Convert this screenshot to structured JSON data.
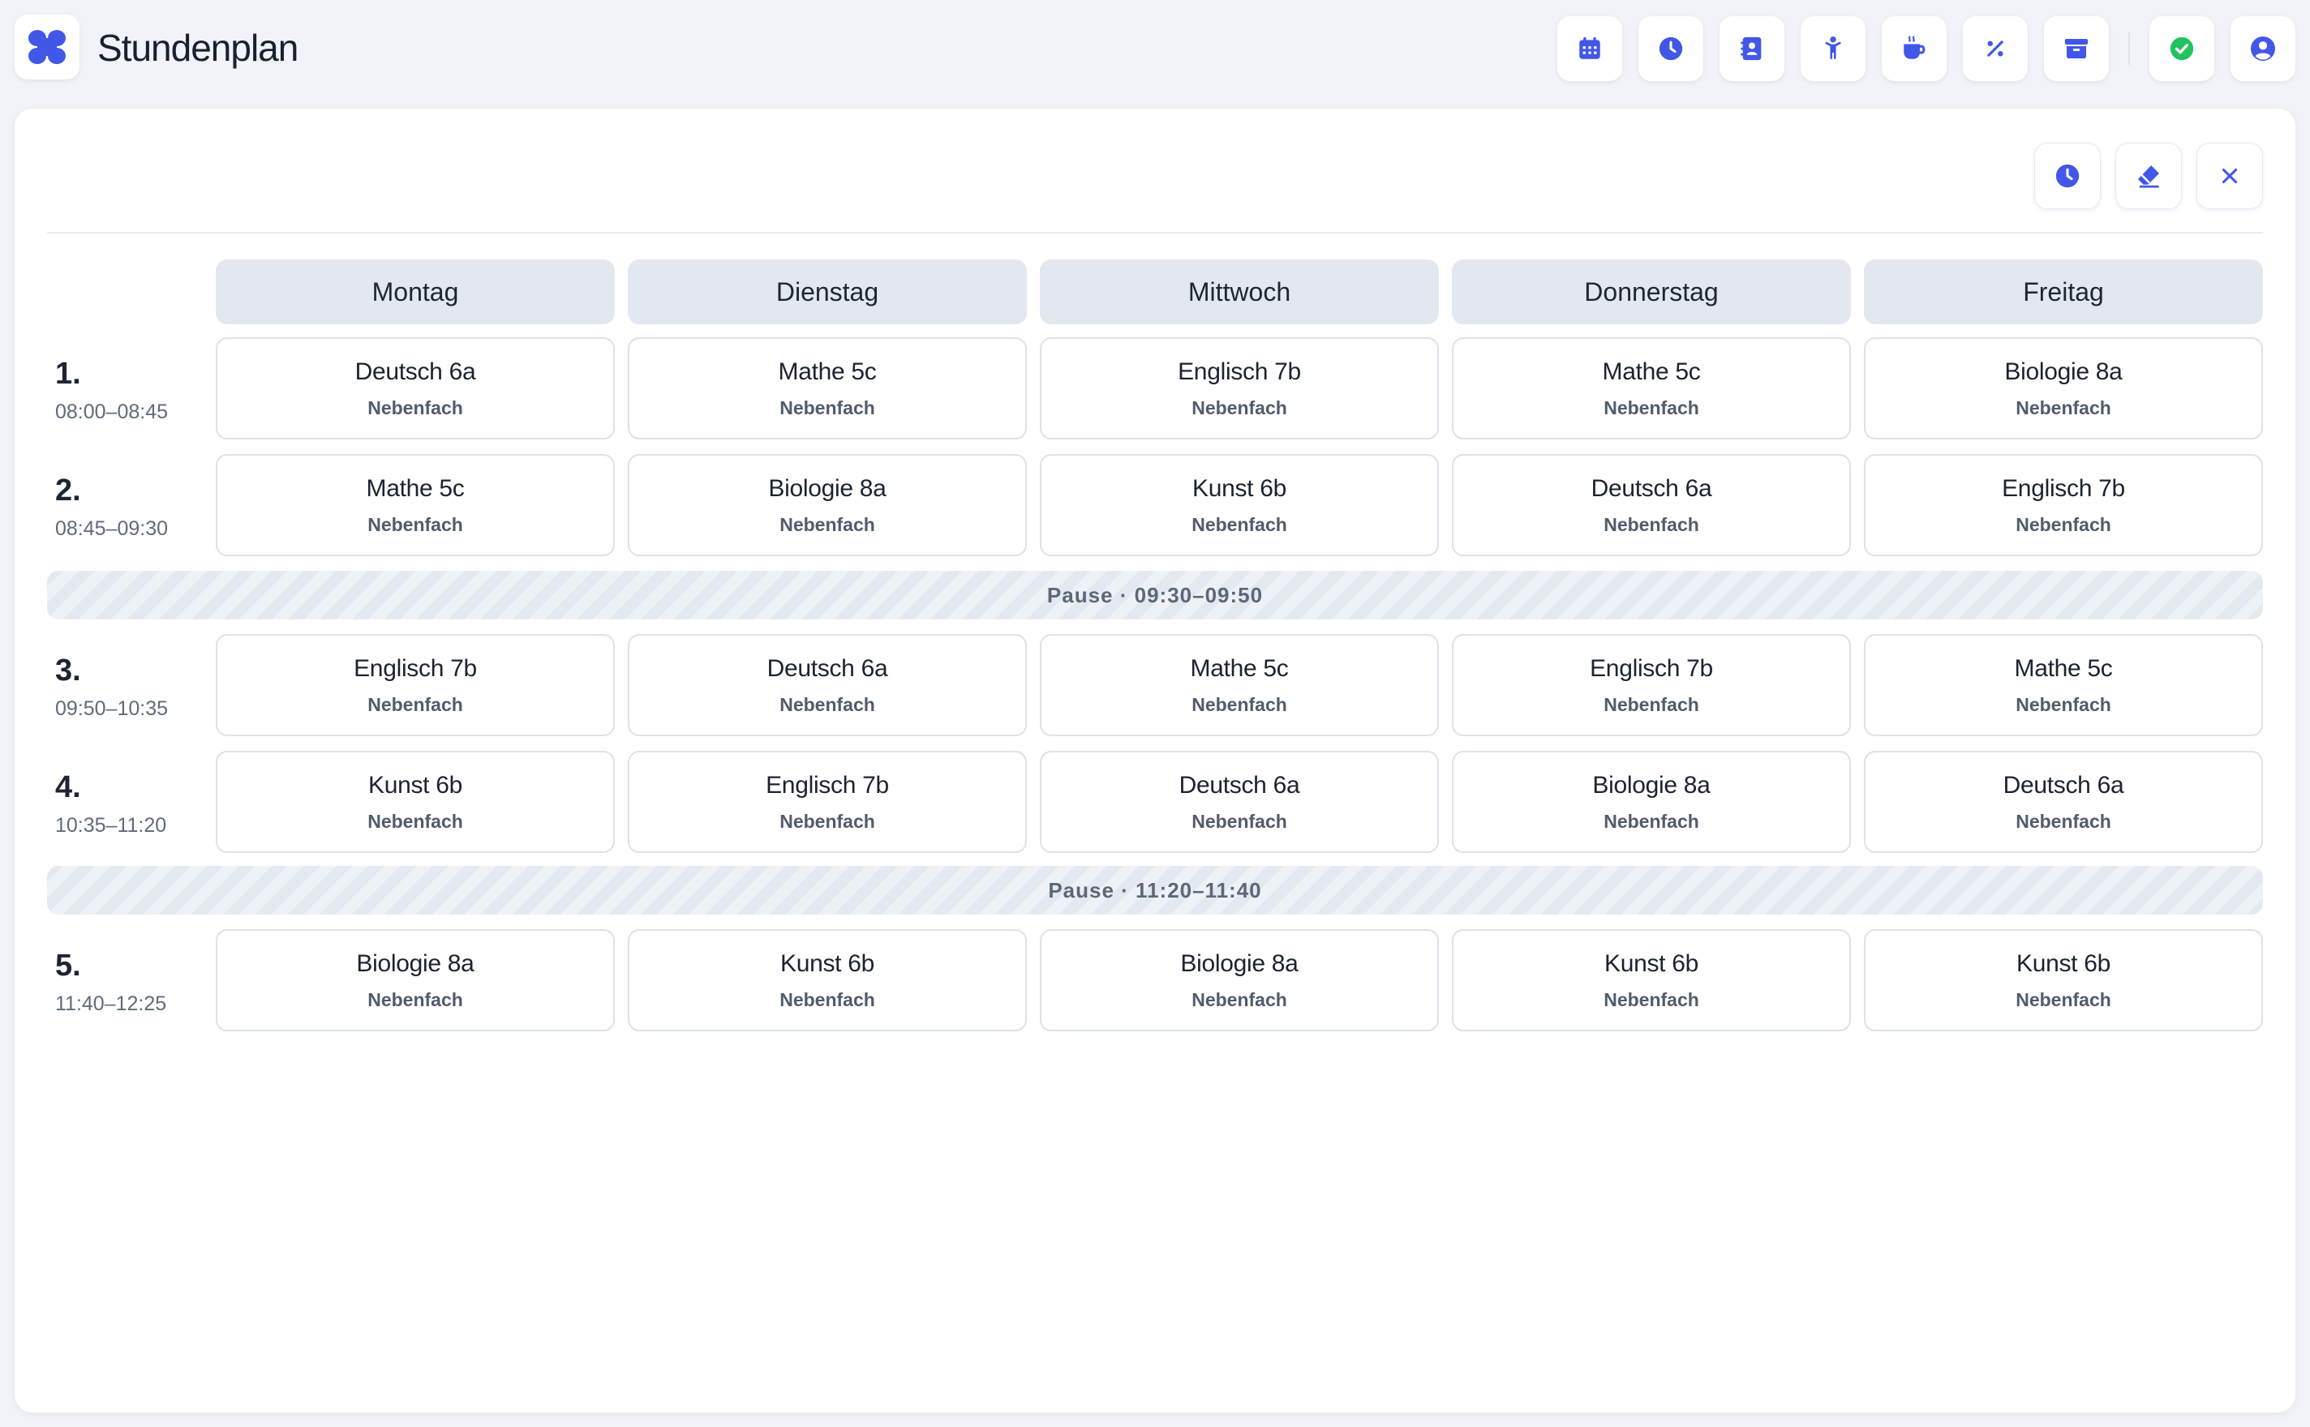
{
  "app": {
    "title": "Stundenplan"
  },
  "toolbar": {
    "icons": [
      "calendar-icon",
      "clock-icon",
      "contacts-icon",
      "child-icon",
      "coffee-icon",
      "percent-icon",
      "archive-icon",
      "check-circle-icon",
      "user-circle-icon"
    ]
  },
  "card_actions": [
    "clock-icon",
    "eraser-icon",
    "close-icon"
  ],
  "colors": {
    "accent": "#4257e8",
    "success": "#22c35e"
  },
  "days": [
    "Montag",
    "Dienstag",
    "Mittwoch",
    "Donnerstag",
    "Freitag"
  ],
  "periods": [
    {
      "num": "1.",
      "time": "08:00–08:45"
    },
    {
      "num": "2.",
      "time": "08:45–09:30"
    },
    {
      "num": "3.",
      "time": "09:50–10:35"
    },
    {
      "num": "4.",
      "time": "10:35–11:20"
    },
    {
      "num": "5.",
      "time": "11:40–12:25"
    }
  ],
  "pauses": [
    "Pause · 09:30–09:50",
    "Pause · 11:20–11:40"
  ],
  "schedule": [
    [
      {
        "subject": "Deutsch 6a",
        "type": "Nebenfach"
      },
      {
        "subject": "Mathe 5c",
        "type": "Nebenfach"
      },
      {
        "subject": "Englisch 7b",
        "type": "Nebenfach"
      },
      {
        "subject": "Mathe 5c",
        "type": "Nebenfach"
      },
      {
        "subject": "Biologie 8a",
        "type": "Nebenfach"
      }
    ],
    [
      {
        "subject": "Mathe 5c",
        "type": "Nebenfach"
      },
      {
        "subject": "Biologie 8a",
        "type": "Nebenfach"
      },
      {
        "subject": "Kunst 6b",
        "type": "Nebenfach"
      },
      {
        "subject": "Deutsch 6a",
        "type": "Nebenfach"
      },
      {
        "subject": "Englisch 7b",
        "type": "Nebenfach"
      }
    ],
    [
      {
        "subject": "Englisch 7b",
        "type": "Nebenfach"
      },
      {
        "subject": "Deutsch 6a",
        "type": "Nebenfach"
      },
      {
        "subject": "Mathe 5c",
        "type": "Nebenfach"
      },
      {
        "subject": "Englisch 7b",
        "type": "Nebenfach"
      },
      {
        "subject": "Mathe 5c",
        "type": "Nebenfach"
      }
    ],
    [
      {
        "subject": "Kunst 6b",
        "type": "Nebenfach"
      },
      {
        "subject": "Englisch 7b",
        "type": "Nebenfach"
      },
      {
        "subject": "Deutsch 6a",
        "type": "Nebenfach"
      },
      {
        "subject": "Biologie 8a",
        "type": "Nebenfach"
      },
      {
        "subject": "Deutsch 6a",
        "type": "Nebenfach"
      }
    ],
    [
      {
        "subject": "Biologie 8a",
        "type": "Nebenfach"
      },
      {
        "subject": "Kunst 6b",
        "type": "Nebenfach"
      },
      {
        "subject": "Biologie 8a",
        "type": "Nebenfach"
      },
      {
        "subject": "Kunst 6b",
        "type": "Nebenfach"
      },
      {
        "subject": "Kunst 6b",
        "type": "Nebenfach"
      }
    ]
  ]
}
